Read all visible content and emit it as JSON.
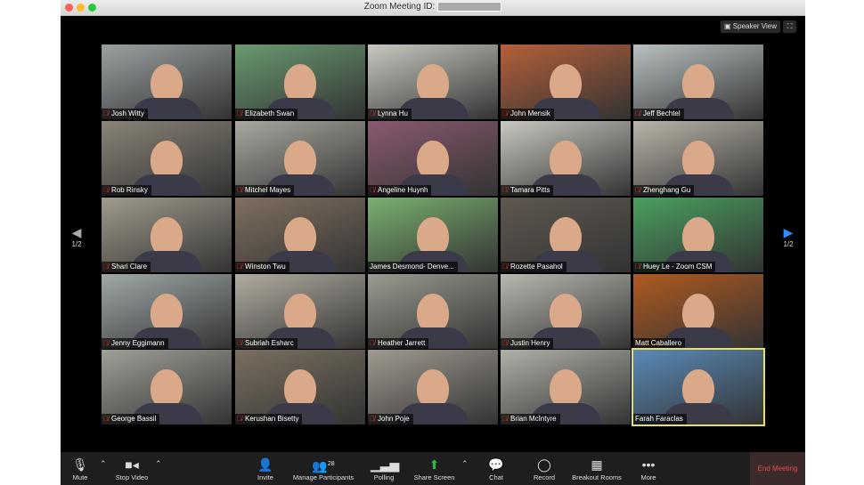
{
  "window": {
    "title_prefix": "Zoom Meeting ID:"
  },
  "view": {
    "speaker_view": "Speaker View",
    "fullscreen_icon": "fullscreen-icon"
  },
  "pagination": {
    "left": "1/2",
    "right": "1/2"
  },
  "participants": [
    {
      "name": "Josh Witty",
      "muted": true,
      "bg": "#9aa0a0"
    },
    {
      "name": "Elizabeth Swan",
      "muted": true,
      "bg": "#6a9a70"
    },
    {
      "name": "Lynna Hu",
      "muted": true,
      "bg": "#c8c8c0"
    },
    {
      "name": "John Mensik",
      "muted": true,
      "bg": "#b4603a"
    },
    {
      "name": "Jeff Bechtel",
      "muted": true,
      "bg": "#b8c0c0"
    },
    {
      "name": "Rob Rinsky",
      "muted": true,
      "bg": "#8a8478"
    },
    {
      "name": "Mitchel Mayes",
      "muted": true,
      "bg": "#a8a8a0"
    },
    {
      "name": "Angeline Huynh",
      "muted": true,
      "bg": "#8a5a70"
    },
    {
      "name": "Tamara Pitts",
      "muted": true,
      "bg": "#c8c8c0"
    },
    {
      "name": "Zhenghang Gu",
      "muted": true,
      "bg": "#b8b4a8"
    },
    {
      "name": "Shari Clare",
      "muted": true,
      "bg": "#a09a8c"
    },
    {
      "name": "Winston Twu",
      "muted": true,
      "bg": "#807060"
    },
    {
      "name": "James Desmond- Denve...",
      "muted": false,
      "bg": "#7ab070"
    },
    {
      "name": "Rozette Pasahol",
      "muted": true,
      "bg": "#605850"
    },
    {
      "name": "Huey Le - Zoom CSM",
      "muted": true,
      "bg": "#4aa060"
    },
    {
      "name": "Jenny Eggimann",
      "muted": true,
      "bg": "#a0a8a8"
    },
    {
      "name": "Subriah Esharc",
      "muted": true,
      "bg": "#b0aca0"
    },
    {
      "name": "Heather Jarrett",
      "muted": true,
      "bg": "#9a9a90"
    },
    {
      "name": "Justin Henry",
      "muted": true,
      "bg": "#b8b8b0"
    },
    {
      "name": "Matt Caballero",
      "muted": false,
      "bg": "#b05a20"
    },
    {
      "name": "George Bassil",
      "muted": true,
      "bg": "#a0a098"
    },
    {
      "name": "Kerushan Bisetty",
      "muted": true,
      "bg": "#7a7060"
    },
    {
      "name": "John Poje",
      "muted": true,
      "bg": "#a09a90"
    },
    {
      "name": "Brian McIntyre",
      "muted": true,
      "bg": "#b0b0a8"
    },
    {
      "name": "Farah Faraclas",
      "muted": false,
      "bg": "#5a8ab8",
      "active": true
    }
  ],
  "toolbar": {
    "mute": "Mute",
    "stop_video": "Stop Video",
    "invite": "Invite",
    "manage_participants": "Manage Participants",
    "participant_count": "28",
    "polling": "Polling",
    "share_screen": "Share Screen",
    "chat": "Chat",
    "record": "Record",
    "breakout_rooms": "Breakout Rooms",
    "more": "More",
    "end_meeting": "End Meeting"
  },
  "colors": {
    "share": "#2fb84a",
    "end": "#f04848",
    "active_border": "#e6e063",
    "arrow_right": "#2d8cff"
  }
}
